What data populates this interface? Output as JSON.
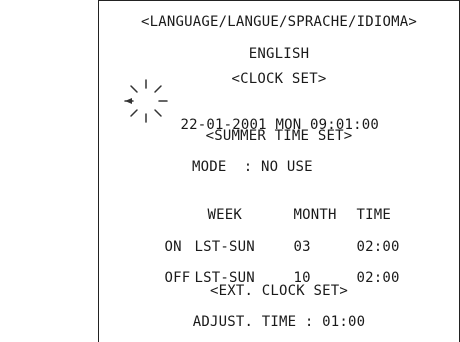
{
  "menu": {
    "language_header": "<LANGUAGE/LANGUE/SPRACHE/IDIOMA>",
    "language_value": "ENGLISH",
    "clock_header": "<CLOCK SET>",
    "clock": {
      "day": "22",
      "rest": "-01-2001 MON 09:01:00"
    },
    "summer_header": "<SUMMER TIME SET>",
    "mode_line": "MODE  : NO USE",
    "table": {
      "headers": [
        "WEEK",
        "MONTH",
        "TIME"
      ],
      "rows": [
        {
          "label": "ON",
          "week": "LST-SUN",
          "month": "03",
          "time": "02:00"
        },
        {
          "label": "OFF",
          "week": "LST-SUN",
          "month": "10",
          "time": "02:00"
        }
      ]
    },
    "ext_header": "<EXT. CLOCK SET>",
    "adjust_line": "ADJUST. TIME : 01:00"
  },
  "icons": {
    "cursor": "sparkle-cursor-icon"
  },
  "colors": {
    "background": "#ffffff",
    "text": "#1a1a1a"
  }
}
